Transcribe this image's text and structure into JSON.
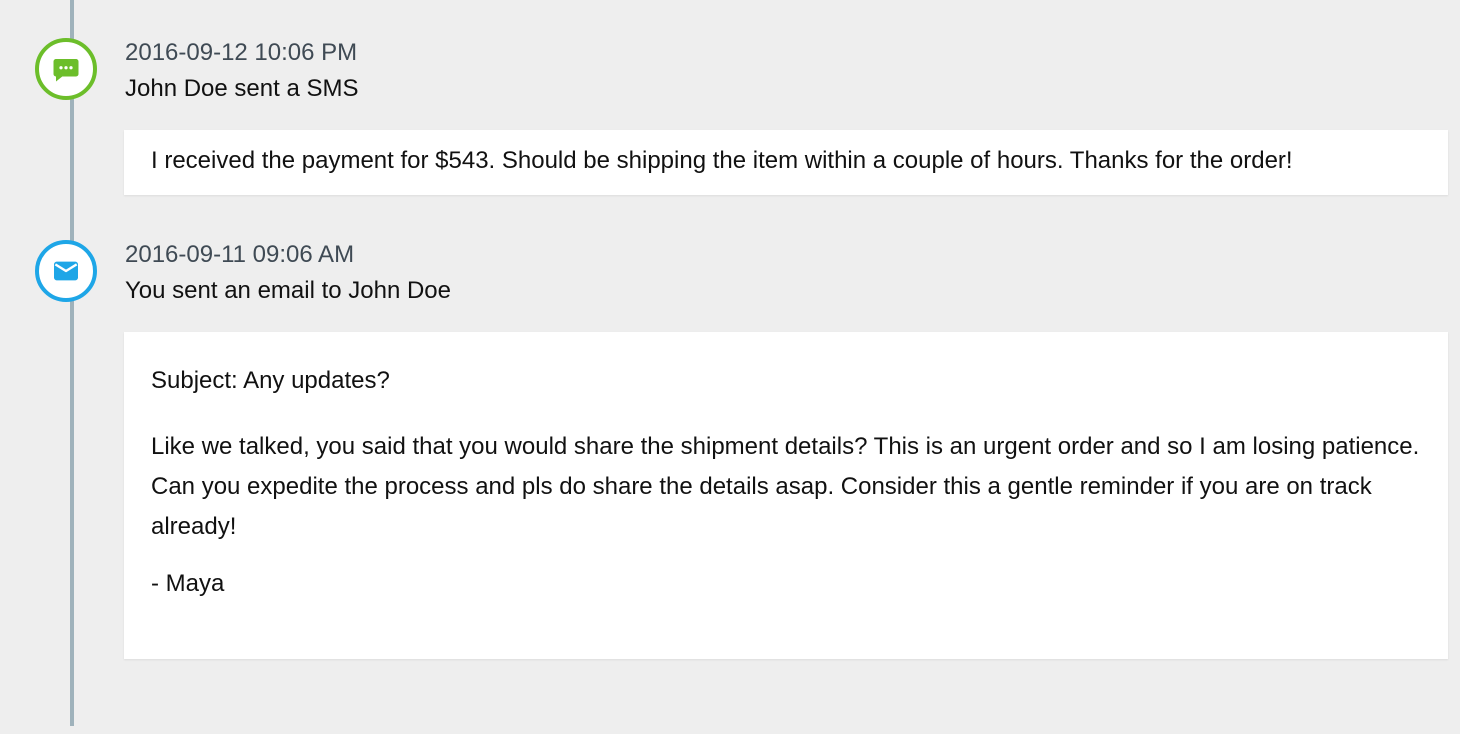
{
  "timeline": {
    "events": [
      {
        "type": "sms",
        "icon": "sms-icon",
        "color": "#6cbe2a",
        "timestamp": "2016-09-12 10:06 PM",
        "title": "John Doe sent a SMS",
        "message": "I received the payment for $543. Should be shipping the item within a couple of hours. Thanks for the order!"
      },
      {
        "type": "email",
        "icon": "email-icon",
        "color": "#1ea6e7",
        "timestamp": "2016-09-11 09:06 AM",
        "title": "You sent an email to John Doe",
        "subject": "Subject: Any updates?",
        "body": "Like we talked, you said that you would share the shipment details? This is an urgent order and so I am losing patience. Can you expedite the process and pls do share the details asap. Consider this a gentle reminder if you are on track already!",
        "signature": "- Maya"
      }
    ]
  }
}
